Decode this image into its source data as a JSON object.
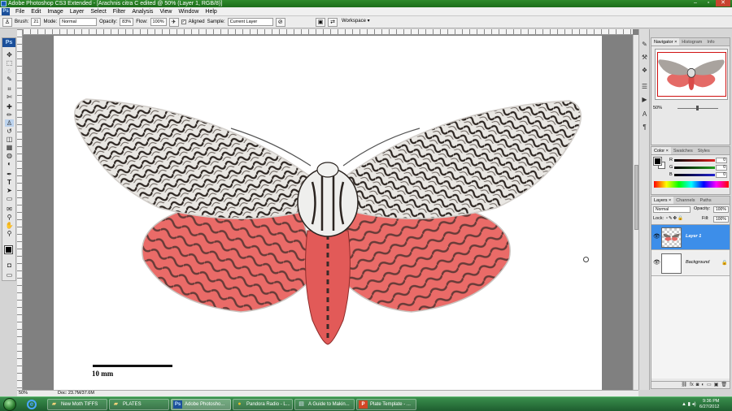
{
  "window": {
    "title": "Adobe Photoshop CS3 Extended - [Arachnis citra C edited @ 50% (Layer 1, RGB/8)]",
    "controls": [
      "–",
      "▫",
      "✕"
    ]
  },
  "menubar": {
    "app_badge": "Ps",
    "items": [
      "File",
      "Edit",
      "Image",
      "Layer",
      "Select",
      "Filter",
      "Analysis",
      "View",
      "Window",
      "Help"
    ]
  },
  "options_bar": {
    "brush_label": "Brush:",
    "brush_size": "21",
    "mode_label": "Mode:",
    "mode_value": "Normal",
    "opacity_label": "Opacity:",
    "opacity_value": "83%",
    "flow_label": "Flow:",
    "flow_value": "100%",
    "aligned_label": "Aligned",
    "aligned_checked": true,
    "sample_label": "Sample:",
    "sample_value": "Current Layer",
    "workspace_label": "Workspace ▾"
  },
  "toolbox": {
    "logo": "Ps",
    "tools": [
      "move",
      "marquee",
      "lasso",
      "quick-select",
      "crop",
      "slice",
      "healing",
      "brush",
      "clone-stamp",
      "history-brush",
      "eraser",
      "gradient",
      "blur",
      "dodge",
      "pen",
      "type",
      "path-select",
      "shape",
      "notes",
      "eyedropper",
      "hand",
      "zoom"
    ],
    "tool_glyphs": [
      "✥",
      "⬚",
      "◌",
      "✎",
      "⌗",
      "✄",
      "✚",
      "✏",
      "♙",
      "↺",
      "◫",
      "▦",
      "◍",
      "◐",
      "✒",
      "T",
      "➤",
      "▭",
      "✉",
      "⚲",
      "✋",
      "⚲"
    ]
  },
  "canvas": {
    "scale_label": "10 mm",
    "background": "#ffffff"
  },
  "status_bar": {
    "zoom": "50%",
    "doc_info": "Doc: 23.7M/37.6M"
  },
  "navigator": {
    "tabs": [
      "Navigator ×",
      "Histogram",
      "Info"
    ],
    "zoom_value": "50%"
  },
  "color_panel": {
    "tabs": [
      "Color ×",
      "Swatches",
      "Styles"
    ],
    "channels": [
      {
        "letter": "R",
        "value": "0",
        "color": "#e02020"
      },
      {
        "letter": "G",
        "value": "0",
        "color": "#20a020"
      },
      {
        "letter": "B",
        "value": "0",
        "color": "#2020d0"
      }
    ]
  },
  "layers_panel": {
    "tabs": [
      "Layers ×",
      "Channels",
      "Paths"
    ],
    "blend_mode": "Normal",
    "opacity_label": "Opacity:",
    "opacity_value": "100%",
    "lock_label": "Lock:",
    "fill_label": "Fill:",
    "fill_value": "100%",
    "layers": [
      {
        "name": "Layer 1",
        "selected": true
      },
      {
        "name": "Background",
        "selected": false
      }
    ],
    "footer_icons": [
      "fx",
      "◙",
      "◐",
      "▭",
      "▣",
      "🗑"
    ]
  },
  "taskbar": {
    "items": [
      {
        "label": "New Moth TIFFS",
        "icon": "folder-icon",
        "glyph": "▰"
      },
      {
        "label": "PLATES",
        "icon": "folder-icon",
        "glyph": "▰"
      },
      {
        "label": "Adobe Photosho...",
        "icon": "photoshop-icon",
        "glyph": "Ps"
      },
      {
        "label": "Pandora Radio - L...",
        "icon": "chrome-icon",
        "glyph": "●"
      },
      {
        "label": "A Guide to Makin...",
        "icon": "document-icon",
        "glyph": "▤"
      },
      {
        "label": "Plate Template - ...",
        "icon": "powerpoint-icon",
        "glyph": "P"
      }
    ],
    "time": "9:36 PM",
    "date": "6/27/2012"
  },
  "colors": {
    "titlebar": "#2a8a2a",
    "taskbar": "#2e7d3e",
    "selected_layer": "#3d8ee9",
    "moth_pink": "#e96a6a",
    "moth_dark": "#2d2420"
  }
}
